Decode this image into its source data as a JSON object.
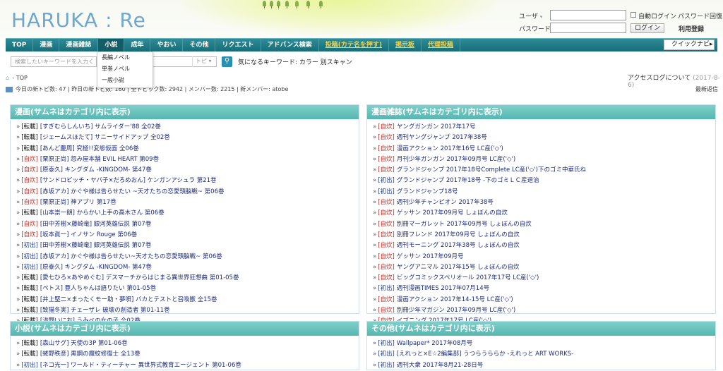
{
  "site": {
    "logo": "HARUKA : Re"
  },
  "login": {
    "user_label": "ユーザ",
    "password_label": "パスワード",
    "auto_login": "自動ログイン",
    "reset": "パスワード回復",
    "login_button": "ログイン",
    "register": "利用登録"
  },
  "nav": {
    "items": [
      "TOP",
      "漫画",
      "漫画雑誌",
      "小説",
      "成年",
      "やおい",
      "その他",
      "リクエスト",
      "アドバンス検索",
      "投稿(カテ名を押す)",
      "掲示板",
      "代理投稿"
    ],
    "quick": "クイックナビ"
  },
  "dropdown": {
    "items": [
      "長編ノベル",
      "単巻ノベル",
      "一般小説"
    ]
  },
  "search": {
    "placeholder": "検索したいキーワードを入力く",
    "topic": "トピ",
    "keywords": "気になるキーワード: カラー 別スキャン"
  },
  "breadcrumb": "TOP",
  "access_log": {
    "text": "アクセスログについて",
    "date": "(2017-8-6)"
  },
  "stats": {
    "text": "今日の新トピ数: 47 | 昨日の新トピ数: 160 | 全トピック数: 2942 | メンバー数: 2215 | 新メンバー: atobe",
    "recent": "最新返信"
  },
  "panels": [
    {
      "title": "漫画(サムネはカテゴリ内に表示)",
      "items": [
        {
          "tag": "[転載]",
          "t": "tk",
          "text": "[すぎむらしんいち] サムライダー'88 全02巻"
        },
        {
          "tag": "[転載]",
          "t": "tk",
          "text": "[ジェームスほたて] サニーサイドアップ 全02巻"
        },
        {
          "tag": "[転載]",
          "t": "tk",
          "text": "[あんど慶周] 究極!!変態仮面 全06巻"
        },
        {
          "tag": "[自炊]",
          "t": "ji",
          "text": "[栗原正尚] 怨み屋本舗 EVIL HEART 第09巻"
        },
        {
          "tag": "[自炊]",
          "t": "ji",
          "text": "[原泰久] キングダム -KINGDOM- 第47巻"
        },
        {
          "tag": "[自炊]",
          "t": "ji",
          "text": "[サンドロビッチ・ヤバ子×だろめおん] ケンガンアシュラ 第21巻"
        },
        {
          "tag": "[自炊]",
          "t": "ji",
          "text": "[赤坂アカ] かぐや様は告らせたい ~天才たちの恋愛頭脳戦~ 第06巻"
        },
        {
          "tag": "[自炊]",
          "t": "ji",
          "text": "[栗原正尚] 神アプリ 第17巻"
        },
        {
          "tag": "[転載]",
          "t": "tk",
          "text": "[山本崇一朗] からかい上手の高木さん 第06巻"
        },
        {
          "tag": "[自炊]",
          "t": "ji",
          "text": "[田中芳樹×藤崎竜] 銀河英雄伝説 第07巻"
        },
        {
          "tag": "[自炊]",
          "t": "ji",
          "text": "[坂本眞一] イノサン Rouge 第06巻"
        },
        {
          "tag": "[初出]",
          "t": "sh",
          "text": "[田中芳樹×藤崎竜] 銀河英雄伝説 第07巻"
        },
        {
          "tag": "[初出]",
          "t": "sh",
          "text": "[赤坂アカ] かぐや様は告らせたい~天才たちの恋愛頭脳戦~ 第06巻"
        },
        {
          "tag": "[初出]",
          "t": "sh",
          "text": "[原泰久] キングダム -KINGDOM- 第47巻"
        },
        {
          "tag": "[転載]",
          "t": "tk",
          "text": "[愛七ひろ×あやめぐむ] デスマーチからはじまる異世界狂想曲 第01-05巻"
        },
        {
          "tag": "[転載]",
          "t": "tk",
          "text": "[ペトス] 亜人ちゃんは語りたい 第01-05巻"
        },
        {
          "tag": "[転載]",
          "t": "tk",
          "text": "[井上堅二×まったくモー助・夢唄] バカとテストと召喚獣 全15巻"
        },
        {
          "tag": "[転載]",
          "t": "tk",
          "text": "[致猫冬実] チェーザレ 破壊の創造者 第01-11巻"
        },
        {
          "tag": "[転載]",
          "t": "tk",
          "text": "[浅野いにお] うみべの女の子 全02巻"
        },
        {
          "tag": "[転載]",
          "t": "tk",
          "text": "[水あさと] 世界制服セキララ女学館 全03巻"
        }
      ]
    },
    {
      "title": "漫画雑誌(サムネはカテゴリ内に表示)",
      "items": [
        {
          "tag": "[自炊]",
          "t": "ji",
          "text": "ヤングガンガン 2017年17号"
        },
        {
          "tag": "[自炊]",
          "t": "ji",
          "text": "週刊ヤングジャンプ 2017年38号"
        },
        {
          "tag": "[自炊]",
          "t": "ji",
          "text": "漫画アクション 2017年16号 LC産('◇')"
        },
        {
          "tag": "[自炊]",
          "t": "ji",
          "text": "月刊少年ガンガン 2017年09月号 LC産('◇')"
        },
        {
          "tag": "[自炊]",
          "t": "ji",
          "text": "グランドジャンプ 2017年18号Complete LC産('◇')下のゴミ中華氏ね"
        },
        {
          "tag": "[初出]",
          "t": "sh",
          "text": "グランドジャンプ 2017年18号 -下のゴミＬＣ産退治"
        },
        {
          "tag": "[初出]",
          "t": "sh",
          "text": "グランドジャンプ18号"
        },
        {
          "tag": "[自炊]",
          "t": "ji",
          "text": "週刊少年チャンピオン 2017年38号"
        },
        {
          "tag": "[自炊]",
          "t": "ji",
          "text": "ゲッサン 2017年09月号 しょぼんの自炊"
        },
        {
          "tag": "[自炊]",
          "t": "ji",
          "text": "別冊マーガレット 2017年09月号 しょぼんの自炊"
        },
        {
          "tag": "[自炊]",
          "t": "ji",
          "text": "別冊フレンド 2017年09月号 しょぼんの自炊"
        },
        {
          "tag": "[自炊]",
          "t": "ji",
          "text": "週刊モーニング 2017年38号 しょぼんの自炊"
        },
        {
          "tag": "[自炊]",
          "t": "ji",
          "text": "ゲッサン 2017年09月号"
        },
        {
          "tag": "[自炊]",
          "t": "ji",
          "text": "ヤングアニマル 2017年15号 しょぼんの自炊"
        },
        {
          "tag": "[自炊]",
          "t": "ji",
          "text": "ビッグコミックスペリオール 2017年17号 LC産('◇')"
        },
        {
          "tag": "[初出]",
          "t": "sh",
          "text": "週刊漫画TIMES 2017年07月14号"
        },
        {
          "tag": "[自炊]",
          "t": "ji",
          "text": "漫画アクション 2017年14-15号 LC産('◇')"
        },
        {
          "tag": "[自炊]",
          "t": "ji",
          "text": "別冊少年マガジン 2017年09月号 LC産('◇')"
        },
        {
          "tag": "[自炊]",
          "t": "ji",
          "text": "イブニング 2017年17号 LC産('◇')"
        },
        {
          "tag": "[初出]",
          "t": "sh",
          "text": "週刊ヤングジャンプ 2017年36-37合併号Complete"
        }
      ]
    },
    {
      "title": "小説(サムネはカテゴリ内に表示)",
      "items": [
        {
          "tag": "[転載]",
          "t": "tk",
          "text": "[森山サグ] 天使の3P 第01-06巻"
        },
        {
          "tag": "[転載]",
          "t": "tk",
          "text": "[蛯野秩彦] 黒鋼の魔紋修復士 全13巻"
        },
        {
          "tag": "[初出]",
          "t": "sh",
          "text": "[ネコ光一] ワールド・ティーチャー 異世界式教育エージェント 第01-06巻"
        }
      ]
    },
    {
      "title": "その他(サムネはカテゴリ内に表示)",
      "items": [
        {
          "tag": "[初出]",
          "t": "sh",
          "text": "Wallpaper* 2017年08月号"
        },
        {
          "tag": "[初出]",
          "t": "sh",
          "text": "[えれっと×E☆2編集部] うつらうららか -えれっと ART WORKS-"
        },
        {
          "tag": "[初出]",
          "t": "sh",
          "text": "週刊大衆 2017年8月21-28日号"
        }
      ]
    }
  ]
}
